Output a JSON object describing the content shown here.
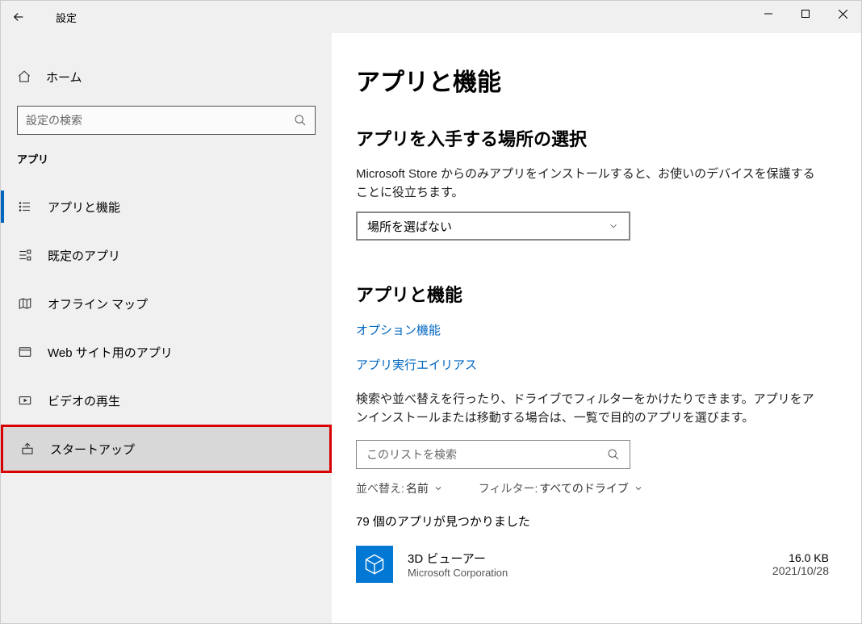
{
  "window": {
    "title": "設定"
  },
  "sidebar": {
    "home": "ホーム",
    "search_placeholder": "設定の検索",
    "section": "アプリ",
    "items": [
      {
        "label": "アプリと機能"
      },
      {
        "label": "既定のアプリ"
      },
      {
        "label": "オフライン マップ"
      },
      {
        "label": "Web サイト用のアプリ"
      },
      {
        "label": "ビデオの再生"
      },
      {
        "label": "スタートアップ"
      }
    ]
  },
  "main": {
    "title": "アプリと機能",
    "source_heading": "アプリを入手する場所の選択",
    "source_desc": "Microsoft Store からのみアプリをインストールすると、お使いのデバイスを保護することに役立ちます。",
    "source_selected": "場所を選ばない",
    "apps_heading": "アプリと機能",
    "link_optional": "オプション機能",
    "link_alias": "アプリ実行エイリアス",
    "list_desc": "検索や並べ替えを行ったり、ドライブでフィルターをかけたりできます。アプリをアンインストールまたは移動する場合は、一覧で目的のアプリを選びます。",
    "list_search_placeholder": "このリストを検索",
    "sort_label": "並べ替え:",
    "sort_value": "名前",
    "filter_label": "フィルター:",
    "filter_value": "すべてのドライブ",
    "count_text": "79 個のアプリが見つかりました",
    "apps": [
      {
        "name": "3D ビューアー",
        "publisher": "Microsoft Corporation",
        "size": "16.0 KB",
        "date": "2021/10/28"
      }
    ]
  }
}
